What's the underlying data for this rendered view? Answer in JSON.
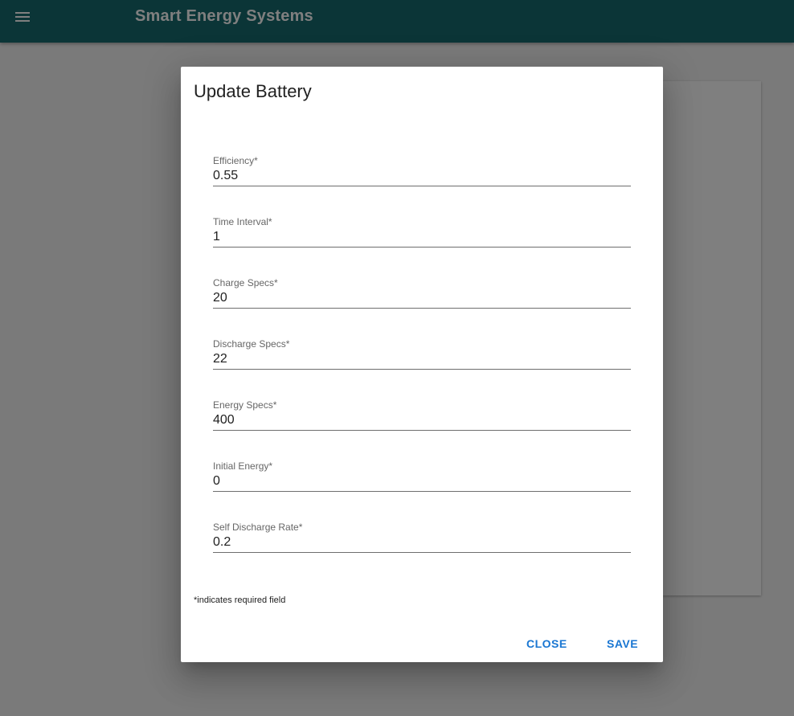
{
  "app": {
    "title": "Smart Energy Systems",
    "menu_icon": "hamburger-menu-icon",
    "appbar_color": "#176b6e"
  },
  "dialog": {
    "title": "Update Battery",
    "fields": [
      {
        "label": "Efficiency*",
        "value": "0.55"
      },
      {
        "label": "Time Interval*",
        "value": "1"
      },
      {
        "label": "Charge Specs*",
        "value": "20"
      },
      {
        "label": "Discharge Specs*",
        "value": "22"
      },
      {
        "label": "Energy Specs*",
        "value": "400"
      },
      {
        "label": "Initial Energy*",
        "value": "0"
      },
      {
        "label": "Self Discharge Rate*",
        "value": "0.2"
      }
    ],
    "required_note": "*indicates required field",
    "close_label": "CLOSE",
    "save_label": "SAVE",
    "button_color": "#1976d2"
  }
}
